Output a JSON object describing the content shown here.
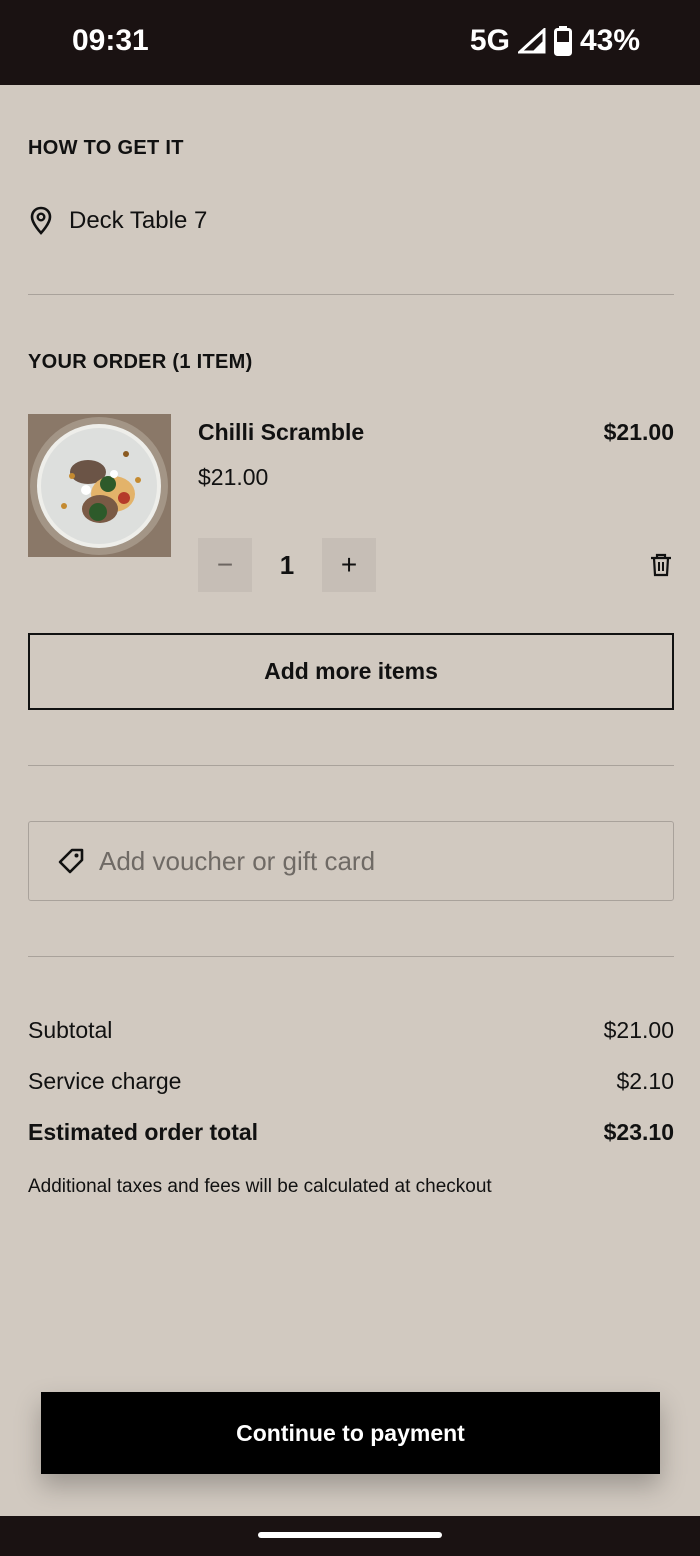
{
  "status": {
    "time": "09:31",
    "network": "5G",
    "battery": "43%"
  },
  "delivery": {
    "title": "HOW TO GET IT",
    "location": "Deck Table 7"
  },
  "order": {
    "title": "YOUR ORDER (1 ITEM)",
    "item": {
      "name": "Chilli Scramble",
      "unit_price": "$21.00",
      "total_price": "$21.00",
      "quantity": "1",
      "minus": "−",
      "plus": "+"
    },
    "add_more_label": "Add more items"
  },
  "voucher": {
    "placeholder": "Add voucher or gift card"
  },
  "totals": {
    "subtotal_label": "Subtotal",
    "subtotal_value": "$21.00",
    "service_label": "Service charge",
    "service_value": "$2.10",
    "total_label": "Estimated order total",
    "total_value": "$23.10",
    "note": "Additional taxes and fees will be calculated at checkout"
  },
  "cta": {
    "label": "Continue to payment"
  },
  "icons": {
    "location": "location-pin-icon",
    "tag": "tag-icon",
    "trash": "trash-icon"
  }
}
